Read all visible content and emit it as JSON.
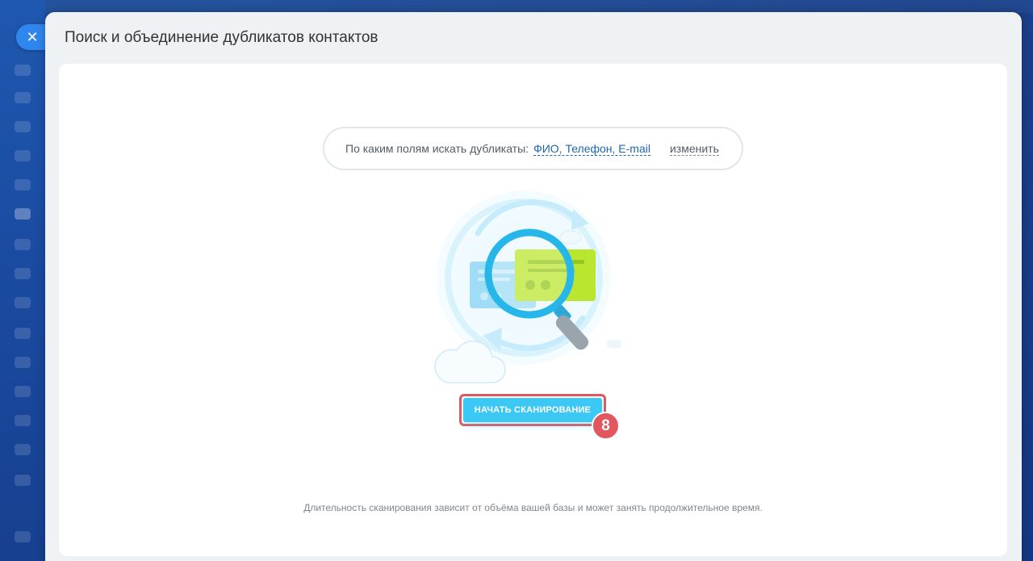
{
  "window": {
    "title": "Поиск и объединение дубликатов контактов",
    "close_icon": "close-icon"
  },
  "search_fields": {
    "label": "По каким полям искать дубликаты:",
    "value": "ФИО, Телефон, E-mail",
    "change_label": "изменить"
  },
  "illustration": {
    "icon": "magnifier-duplicates-illustration"
  },
  "actions": {
    "start_scan_label": "НАЧАТЬ СКАНИРОВАНИЕ",
    "step_badge": "8"
  },
  "note": "Длительность сканирования зависит от объёма вашей базы и может занять продолжительное время.",
  "colors": {
    "accent": "#3bc8f5",
    "link": "#2067b0",
    "highlight": "#e2575f"
  }
}
